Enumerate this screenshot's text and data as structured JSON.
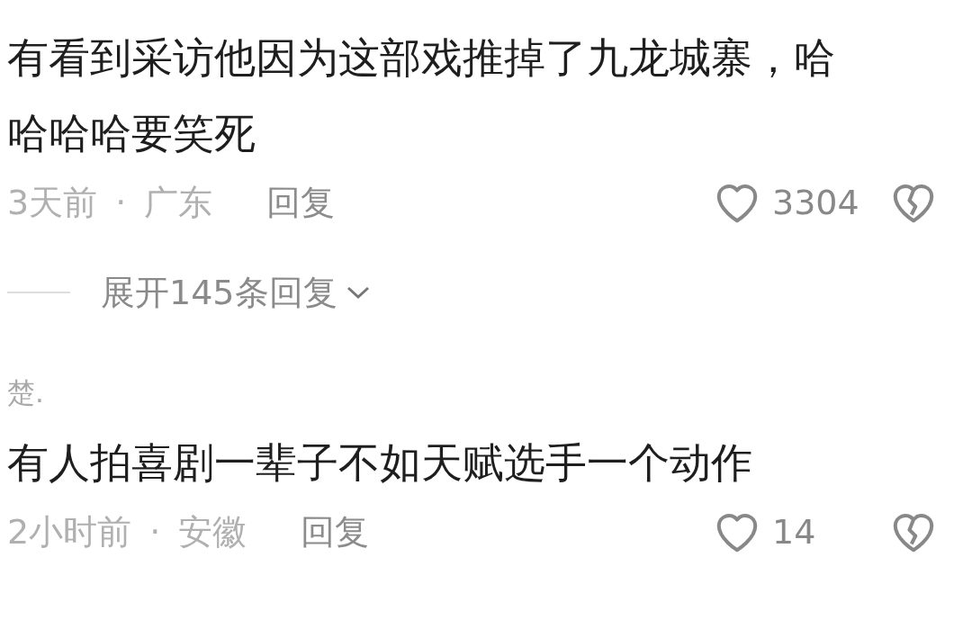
{
  "comments": [
    {
      "text": "有看到采访他因为这部戏推掉了九龙城寨，哈哈哈哈要笑死",
      "time": "3天前",
      "separator": "·",
      "location": "广东",
      "reply_label": "回复",
      "likes": "3304",
      "expand_label": "展开145条回复"
    },
    {
      "author": "楚.",
      "text": "有人拍喜剧一辈子不如天赋选手一个动作",
      "time": "2小时前",
      "separator": "·",
      "location": "安徽",
      "reply_label": "回复",
      "likes": "14"
    }
  ]
}
